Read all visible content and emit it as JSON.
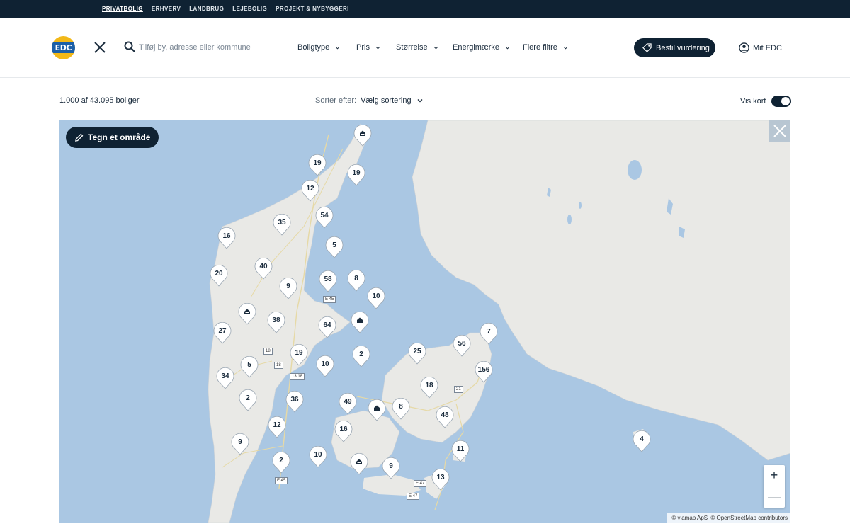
{
  "topnav": {
    "items": [
      "PRIVATBOLIG",
      "ERHVERV",
      "LANDBRUG",
      "LEJEBOLIG",
      "PROJEKT & NYBYGGERI"
    ]
  },
  "header": {
    "logo_text": "EDC",
    "search_placeholder": "Tilføj by, adresse eller kommune",
    "filters": [
      "Boligtype",
      "Pris",
      "Størrelse",
      "Energimærke",
      "Flere filtre"
    ],
    "bestil_label": "Bestil vurdering",
    "mit_label": "Mit EDC"
  },
  "results": {
    "count_text": "1.000 af 43.095 boliger",
    "sort_label": "Sorter efter:",
    "sort_value": "Vælg sortering",
    "viskort_label": "Vis kort"
  },
  "map": {
    "draw_label": "Tegn et område",
    "zoom_in": "+",
    "zoom_out": "—",
    "attribution": [
      "© viamap ApS",
      "© OpenStreetMap contributors"
    ],
    "roads": [
      "E 45",
      "18",
      "18",
      "13;18",
      "21",
      "E 47",
      "E 47",
      "E 45"
    ],
    "markers": [
      {
        "label": "",
        "type": "home"
      },
      {
        "label": "19",
        "type": "count"
      },
      {
        "label": "19",
        "type": "count"
      },
      {
        "label": "12",
        "type": "count"
      },
      {
        "label": "54",
        "type": "count"
      },
      {
        "label": "35",
        "type": "count"
      },
      {
        "label": "16",
        "type": "count"
      },
      {
        "label": "5",
        "type": "count"
      },
      {
        "label": "40",
        "type": "count"
      },
      {
        "label": "20",
        "type": "count"
      },
      {
        "label": "9",
        "type": "count"
      },
      {
        "label": "58",
        "type": "count"
      },
      {
        "label": "8",
        "type": "count"
      },
      {
        "label": "10",
        "type": "count"
      },
      {
        "label": "",
        "type": "home"
      },
      {
        "label": "38",
        "type": "count"
      },
      {
        "label": "64",
        "type": "count"
      },
      {
        "label": "",
        "type": "home"
      },
      {
        "label": "27",
        "type": "count"
      },
      {
        "label": "19",
        "type": "count"
      },
      {
        "label": "5",
        "type": "count"
      },
      {
        "label": "10",
        "type": "count"
      },
      {
        "label": "2",
        "type": "count"
      },
      {
        "label": "25",
        "type": "count"
      },
      {
        "label": "56",
        "type": "count"
      },
      {
        "label": "7",
        "type": "count"
      },
      {
        "label": "156",
        "type": "count"
      },
      {
        "label": "34",
        "type": "count"
      },
      {
        "label": "18",
        "type": "count"
      },
      {
        "label": "2",
        "type": "count"
      },
      {
        "label": "36",
        "type": "count"
      },
      {
        "label": "49",
        "type": "count"
      },
      {
        "label": "",
        "type": "home"
      },
      {
        "label": "8",
        "type": "count"
      },
      {
        "label": "48",
        "type": "count"
      },
      {
        "label": "12",
        "type": "count"
      },
      {
        "label": "16",
        "type": "count"
      },
      {
        "label": "9",
        "type": "count"
      },
      {
        "label": "11",
        "type": "count"
      },
      {
        "label": "4",
        "type": "count"
      },
      {
        "label": "10",
        "type": "count"
      },
      {
        "label": "2",
        "type": "count"
      },
      {
        "label": "",
        "type": "home"
      },
      {
        "label": "9",
        "type": "count"
      },
      {
        "label": "13",
        "type": "count"
      }
    ]
  }
}
